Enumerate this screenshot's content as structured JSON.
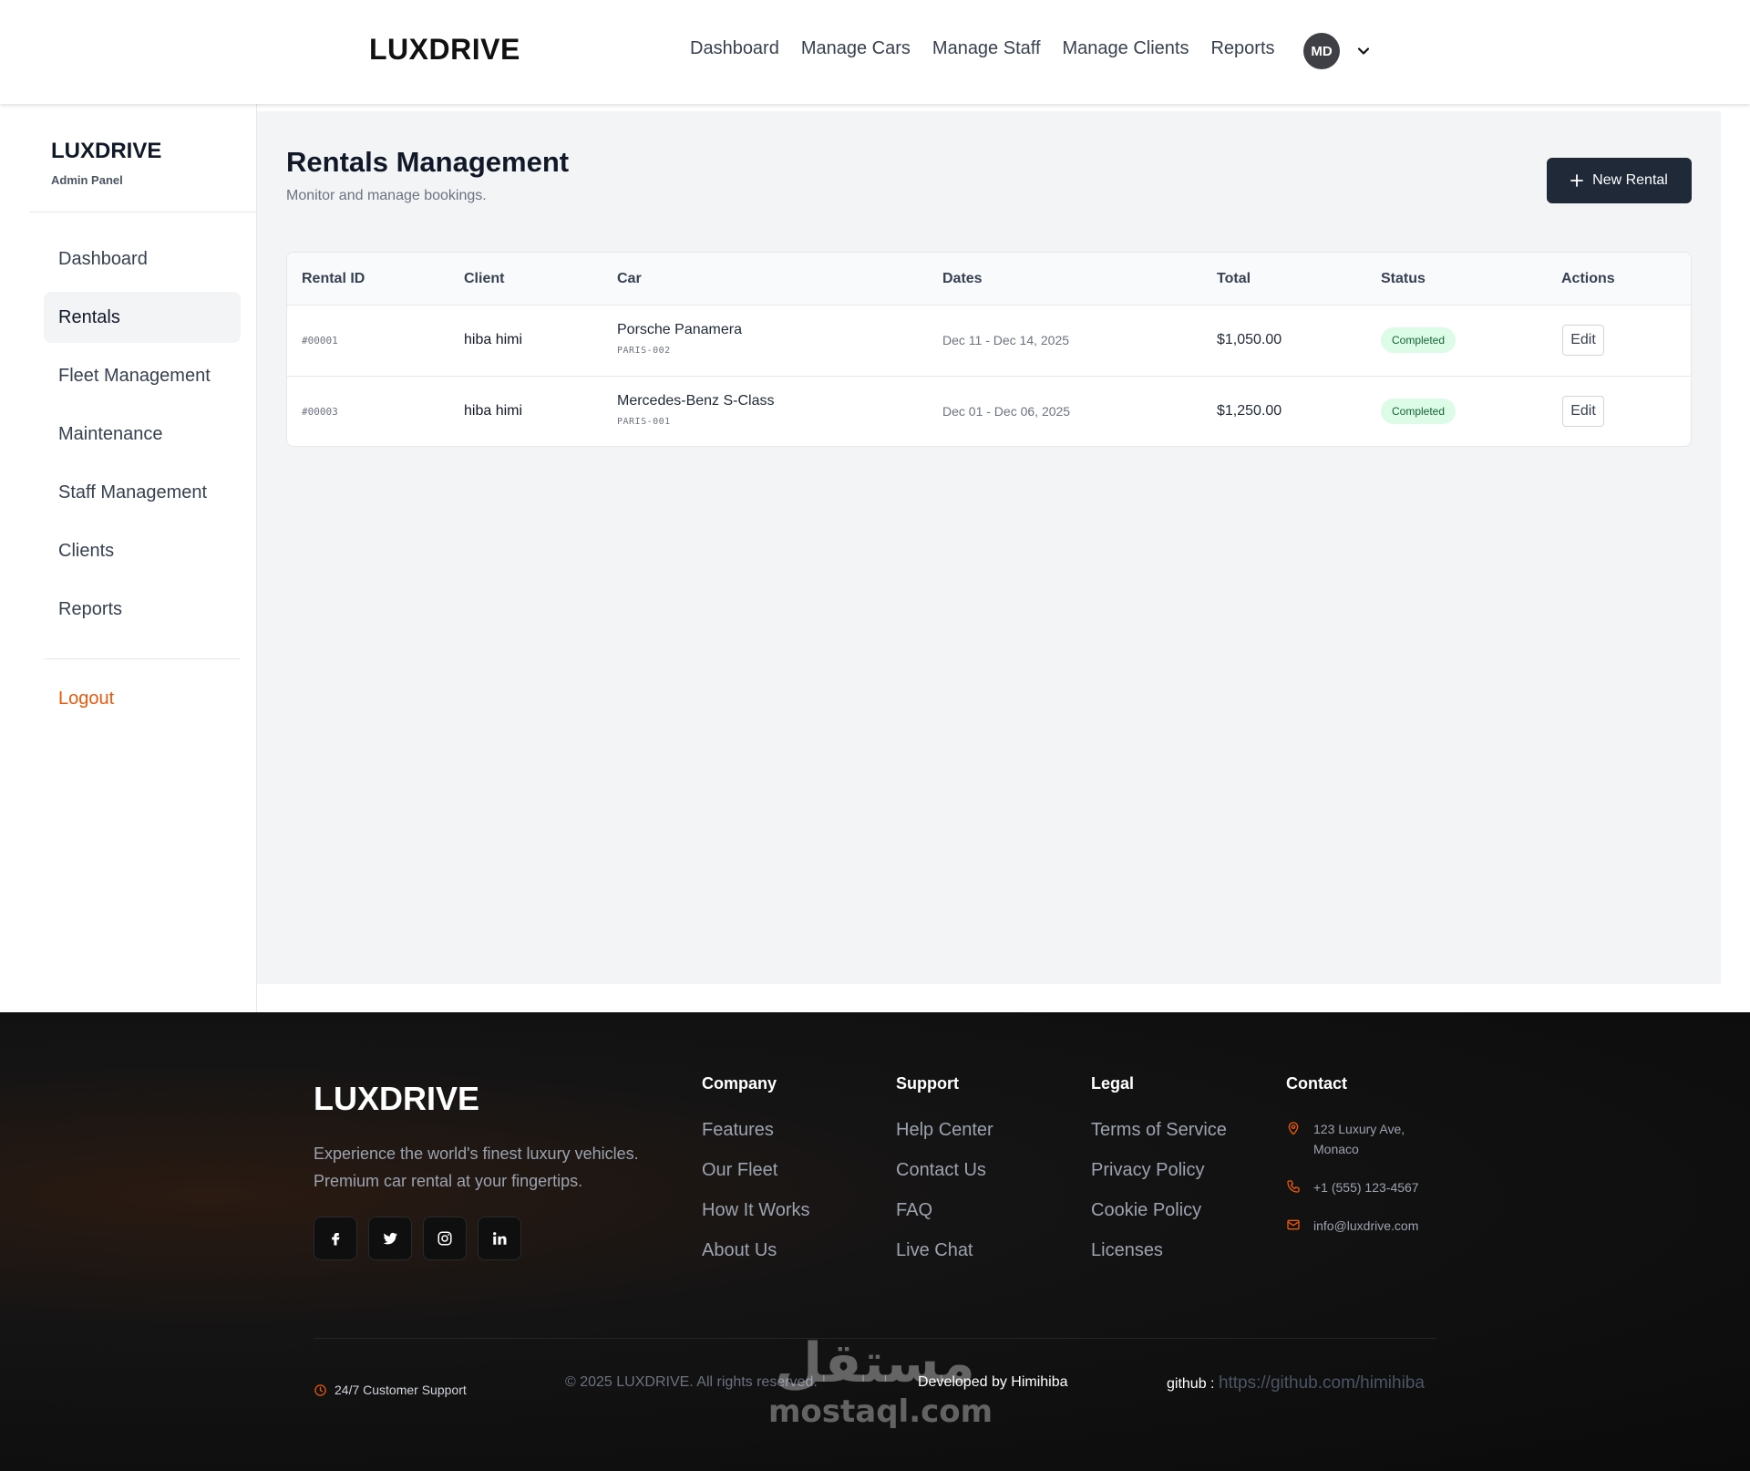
{
  "topbar": {
    "brand": "LUXDRIVE",
    "nav": [
      "Dashboard",
      "Manage Cars",
      "Manage Staff",
      "Manage Clients",
      "Reports"
    ],
    "avatar_initials": "MD",
    "avatar_icon": "chevron-down-icon"
  },
  "sidebar": {
    "brand": "LUXDRIVE",
    "subtitle": "Admin Panel",
    "items": [
      {
        "label": "Dashboard",
        "active": false
      },
      {
        "label": "Rentals",
        "active": true
      },
      {
        "label": "Fleet Management",
        "active": false
      },
      {
        "label": "Maintenance",
        "active": false
      },
      {
        "label": "Staff Management",
        "active": false
      },
      {
        "label": "Clients",
        "active": false
      },
      {
        "label": "Reports",
        "active": false
      }
    ],
    "logout": "Logout"
  },
  "main": {
    "title": "Rentals Management",
    "subtitle": "Monitor and manage bookings.",
    "new_button": "New Rental",
    "table": {
      "headers": [
        "Rental ID",
        "Client",
        "Car",
        "Dates",
        "Total",
        "Status",
        "Actions"
      ],
      "rows": [
        {
          "id": "#00001",
          "client": "hiba himi",
          "car": "Porsche Panamera",
          "car_code": "PARIS-002",
          "dates": "Dec 11 - Dec 14, 2025",
          "total": "$1,050.00",
          "status": "Completed",
          "action": "Edit"
        },
        {
          "id": "#00003",
          "client": "hiba himi",
          "car": "Mercedes-Benz S-Class",
          "car_code": "PARIS-001",
          "dates": "Dec 01 - Dec 06, 2025",
          "total": "$1,250.00",
          "status": "Completed",
          "action": "Edit"
        }
      ]
    }
  },
  "footer": {
    "brand": "LUXDRIVE",
    "description": "Experience the world's finest luxury vehicles. Premium car rental at your fingertips.",
    "socials": [
      "facebook-icon",
      "twitter-icon",
      "instagram-icon",
      "linkedin-icon"
    ],
    "company": {
      "heading": "Company",
      "links": [
        "Features",
        "Our Fleet",
        "How It Works",
        "About Us"
      ]
    },
    "support": {
      "heading": "Support",
      "links": [
        "Help Center",
        "Contact Us",
        "FAQ",
        "Live Chat"
      ]
    },
    "legal": {
      "heading": "Legal",
      "links": [
        "Terms of Service",
        "Privacy Policy",
        "Cookie Policy",
        "Licenses"
      ]
    },
    "contact": {
      "heading": "Contact",
      "address_line1": "123 Luxury Ave,",
      "address_line2": "Monaco",
      "phone": "+1 (555) 123-4567",
      "email": "info@luxdrive.com"
    },
    "support_247": "24/7 Customer Support",
    "copyright": "© 2025 LUXDRIVE. All rights reserved.",
    "developed_by": "Developed by Himihiba",
    "github_label": "github :",
    "github_url": "https://github.com/himihiba",
    "watermark_ar": "مستقل",
    "watermark_en": "mostaql.com",
    "accent_color": "#ea580c"
  }
}
